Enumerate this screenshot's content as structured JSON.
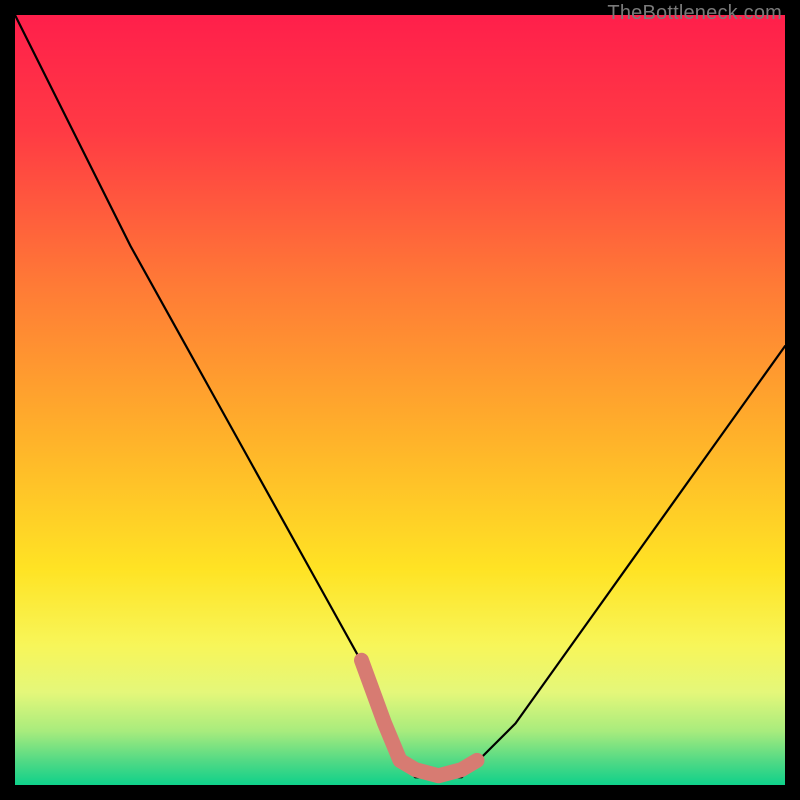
{
  "watermark": "TheBottleneck.com",
  "chart_data": {
    "type": "line",
    "title": "",
    "xlabel": "",
    "ylabel": "",
    "xlim": [
      0,
      100
    ],
    "ylim": [
      0,
      100
    ],
    "grid": false,
    "legend": false,
    "series": [
      {
        "name": "bottleneck-curve",
        "x": [
          0,
          5,
          10,
          15,
          20,
          25,
          30,
          35,
          40,
          45,
          48,
          50,
          52,
          55,
          58,
          60,
          65,
          70,
          75,
          80,
          85,
          90,
          95,
          100
        ],
        "values": [
          100,
          90,
          80,
          70,
          61,
          52,
          43,
          34,
          25,
          16,
          7,
          3,
          1,
          1,
          1,
          3,
          8,
          15,
          22,
          29,
          36,
          43,
          50,
          57
        ]
      }
    ],
    "annotations": [
      {
        "name": "bottom-highlight",
        "x_range": [
          45,
          60
        ],
        "color": "#d77b72"
      }
    ],
    "background_gradient_stops": [
      {
        "pct": 0,
        "color": "#ff1f4b"
      },
      {
        "pct": 15,
        "color": "#ff3a44"
      },
      {
        "pct": 35,
        "color": "#ff7a36"
      },
      {
        "pct": 55,
        "color": "#ffb22a"
      },
      {
        "pct": 72,
        "color": "#ffe324"
      },
      {
        "pct": 82,
        "color": "#f7f65a"
      },
      {
        "pct": 88,
        "color": "#e4f77a"
      },
      {
        "pct": 93,
        "color": "#a8ec7d"
      },
      {
        "pct": 97,
        "color": "#4fd985"
      },
      {
        "pct": 100,
        "color": "#0fd18a"
      }
    ]
  }
}
